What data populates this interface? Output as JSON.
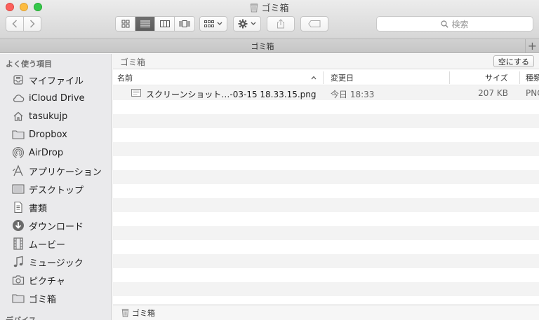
{
  "window": {
    "title": "ゴミ箱",
    "search_placeholder": "検索"
  },
  "tabbar": {
    "label": "ゴミ箱",
    "add": "+"
  },
  "sidebar": {
    "favorites_heading": "よく使う項目",
    "devices_heading": "デバイス",
    "items": [
      {
        "label": "マイファイル",
        "icon": "all-my-files-icon"
      },
      {
        "label": "iCloud Drive",
        "icon": "cloud-icon"
      },
      {
        "label": "tasukujp",
        "icon": "home-icon"
      },
      {
        "label": "Dropbox",
        "icon": "folder-icon"
      },
      {
        "label": "AirDrop",
        "icon": "airdrop-icon"
      },
      {
        "label": "アプリケーション",
        "icon": "applications-icon"
      },
      {
        "label": "デスクトップ",
        "icon": "desktop-icon"
      },
      {
        "label": "書類",
        "icon": "documents-icon"
      },
      {
        "label": "ダウンロード",
        "icon": "download-icon"
      },
      {
        "label": "ムービー",
        "icon": "movies-icon"
      },
      {
        "label": "ミュージック",
        "icon": "music-icon"
      },
      {
        "label": "ピクチャ",
        "icon": "camera-icon"
      },
      {
        "label": "ゴミ箱",
        "icon": "folder-icon"
      }
    ]
  },
  "main": {
    "path_title": "ゴミ箱",
    "empty_button": "空にする",
    "columns": {
      "name": "名前",
      "modified": "変更日",
      "size": "サイズ",
      "kind": "種類"
    },
    "files": [
      {
        "name": "スクリーンショット…-03-15 18.33.15.png",
        "modified": "今日 18:33",
        "size": "207 KB",
        "kind": "PNG"
      }
    ],
    "status": "ゴミ箱"
  },
  "colors": {
    "sidebar_bg": "#eaeaec",
    "stripe": "#f3f3f3",
    "active_segment": "#666666"
  }
}
